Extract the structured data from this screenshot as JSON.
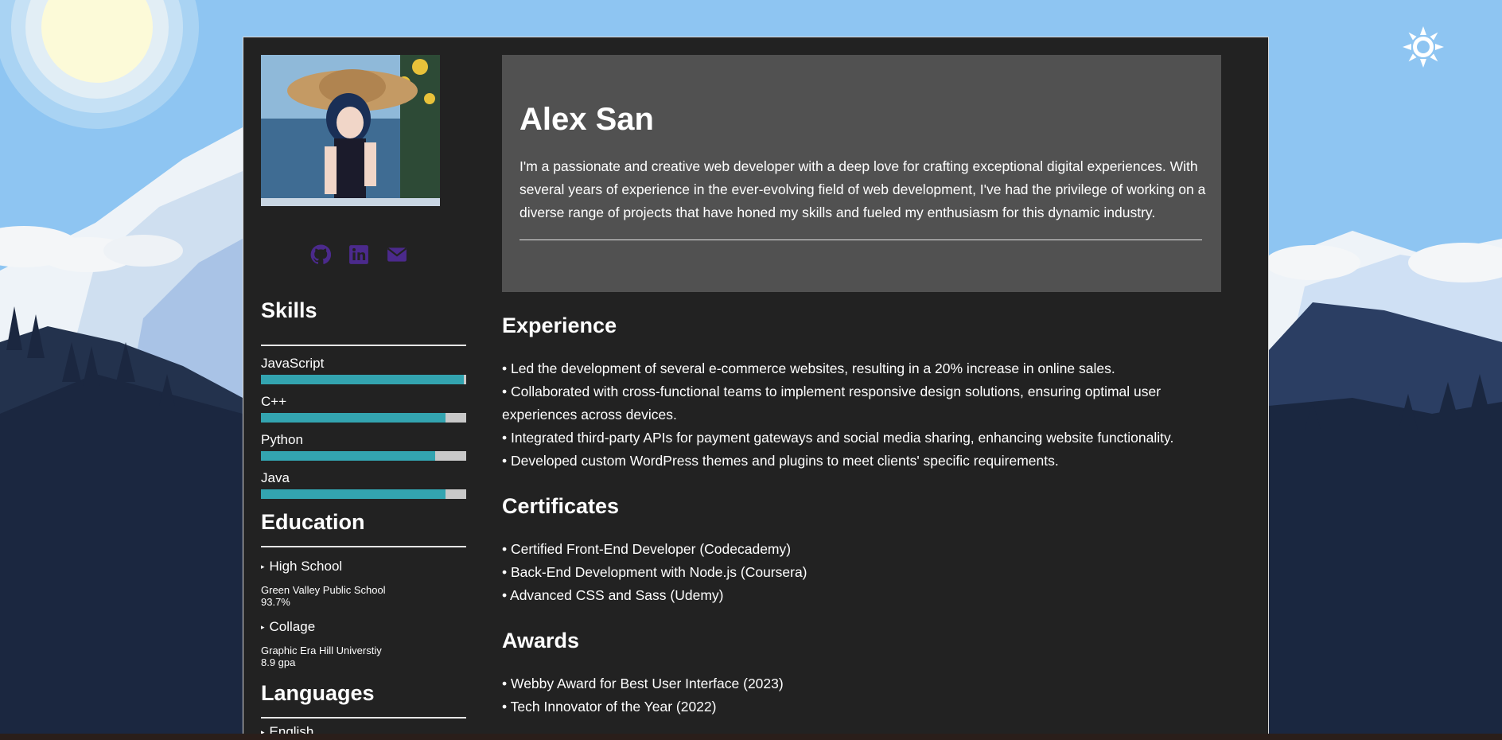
{
  "profile": {
    "name": "Alex San",
    "bio": "I'm a passionate and creative web developer with a deep love for crafting exceptional digital experiences. With several years of experience in the ever-evolving field of web development, I've had the privilege of working on a diverse range of projects that have honed my skills and fueled my enthusiasm for this dynamic industry."
  },
  "socials": [
    {
      "icon": "github-icon"
    },
    {
      "icon": "linkedin-icon"
    },
    {
      "icon": "email-icon"
    }
  ],
  "colors": {
    "card": "#222222",
    "hero": "#515151",
    "skill_bar": "#33a4b0",
    "skill_track": "#c8c8c8",
    "social_icons": "#4b2a8c",
    "sky": "#8ec5f2"
  },
  "skills": {
    "title": "Skills",
    "items": [
      {
        "name": "JavaScript",
        "level": 0.99
      },
      {
        "name": "C++",
        "level": 0.9
      },
      {
        "name": "Python",
        "level": 0.85
      },
      {
        "name": "Java",
        "level": 0.9
      }
    ]
  },
  "education": {
    "title": "Education",
    "items": [
      {
        "label": "High School",
        "school": "Green Valley Public School",
        "score": "93.7%"
      },
      {
        "label": "Collage",
        "school": "Graphic Era Hill Universtiy",
        "score": "8.9 gpa"
      }
    ]
  },
  "languages": {
    "title": "Languages",
    "items": [
      "English"
    ]
  },
  "experience": {
    "title": "Experience",
    "items": [
      "• Led the development of several e-commerce websites, resulting in a 20% increase in online sales.",
      "• Collaborated with cross-functional teams to implement responsive design solutions, ensuring optimal user experiences across devices.",
      "• Integrated third-party APIs for payment gateways and social media sharing, enhancing website functionality.",
      "• Developed custom WordPress themes and plugins to meet clients' specific requirements."
    ]
  },
  "certificates": {
    "title": "Certificates",
    "items": [
      "• Certified Front-End Developer (Codecademy)",
      "• Back-End Development with Node.js (Coursera)",
      "• Advanced CSS and Sass (Udemy)"
    ]
  },
  "awards": {
    "title": "Awards",
    "items": [
      "• Webby Award for Best User Interface (2023)",
      "• Tech Innovator of the Year (2022)"
    ]
  },
  "theme_toggle": {
    "icon": "sun-icon"
  }
}
